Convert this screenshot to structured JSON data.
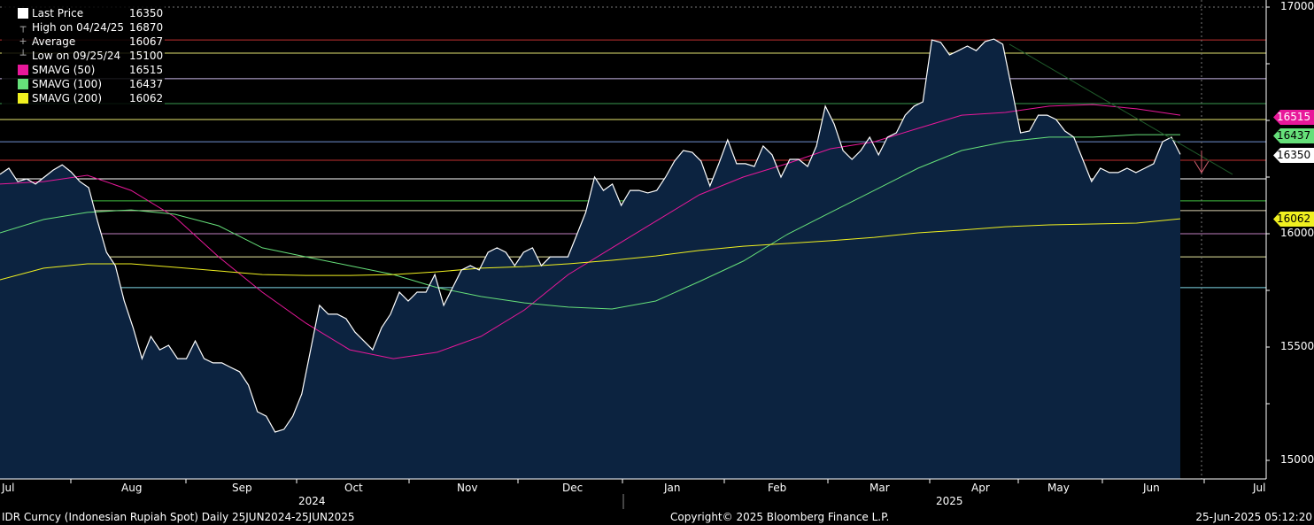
{
  "legend": [
    {
      "label": "Last Price",
      "value": "16350",
      "swatch": "#ffffff",
      "glyph": ""
    },
    {
      "label": "High on 04/24/25",
      "value": "16870",
      "swatch": "",
      "glyph": "┬"
    },
    {
      "label": "Average",
      "value": "16067",
      "swatch": "",
      "glyph": "+"
    },
    {
      "label": "Low on 09/25/24",
      "value": "15100",
      "swatch": "",
      "glyph": "┴"
    },
    {
      "label": "SMAVG (50)",
      "value": "16515",
      "swatch": "#e8189a",
      "glyph": ""
    },
    {
      "label": "SMAVG (100)",
      "value": "16437",
      "swatch": "#66e07a",
      "glyph": ""
    },
    {
      "label": "SMAVG (200)",
      "value": "16062",
      "swatch": "#f0f020",
      "glyph": ""
    }
  ],
  "tags": [
    {
      "value": "16515",
      "bg": "#e8189a",
      "fg": "#ffffff"
    },
    {
      "value": "16437",
      "bg": "#66e07a",
      "fg": "#000000"
    },
    {
      "value": "16350",
      "bg": "#ffffff",
      "fg": "#000000"
    },
    {
      "value": "16062",
      "bg": "#f0f020",
      "fg": "#000000"
    }
  ],
  "chart_data": {
    "type": "line",
    "title": "IDR Curncy (Indonesian Rupiah Spot)",
    "ylim": [
      14920,
      17030
    ],
    "y_ticks": [
      "17000",
      "16000",
      "15500",
      "15000"
    ],
    "y_tick_values": [
      17000,
      16000,
      15500,
      15000
    ],
    "x_months": [
      "Jul",
      "Aug",
      "Sep",
      "Oct",
      "Nov",
      "Dec",
      "Jan",
      "Feb",
      "Mar",
      "Apr",
      "May",
      "Jun",
      "Jul"
    ],
    "x_years": [
      "2024",
      "2025"
    ],
    "series": [
      {
        "name": "Last Price",
        "color": "#ffffff",
        "values": [
          16262,
          16289,
          16230,
          16242,
          16219,
          16250,
          16281,
          16304,
          16273,
          16230,
          16203,
          16055,
          15918,
          15859,
          15703,
          15586,
          15449,
          15547,
          15488,
          15508,
          15449,
          15449,
          15527,
          15449,
          15430,
          15430,
          15410,
          15391,
          15332,
          15215,
          15195,
          15125,
          15137,
          15195,
          15293,
          15488,
          15684,
          15645,
          15645,
          15625,
          15566,
          15527,
          15488,
          15586,
          15645,
          15742,
          15703,
          15742,
          15742,
          15820,
          15684,
          15762,
          15840,
          15859,
          15840,
          15918,
          15938,
          15918,
          15859,
          15918,
          15938,
          15859,
          15898,
          15898,
          15898,
          15996,
          16094,
          16250,
          16191,
          16219,
          16125,
          16191,
          16191,
          16180,
          16191,
          16250,
          16320,
          16367,
          16359,
          16320,
          16211,
          16309,
          16414,
          16309,
          16309,
          16297,
          16387,
          16348,
          16250,
          16328,
          16328,
          16297,
          16387,
          16563,
          16484,
          16367,
          16328,
          16367,
          16426,
          16348,
          16426,
          16445,
          16523,
          16563,
          16582,
          16855,
          16844,
          16789,
          16808,
          16828,
          16808,
          16848,
          16859,
          16836,
          16641,
          16445,
          16453,
          16523,
          16523,
          16504,
          16453,
          16426,
          16328,
          16230,
          16289,
          16270,
          16270,
          16289,
          16270,
          16289,
          16309,
          16406,
          16426,
          16350
        ]
      },
      {
        "name": "SMAVG (50)",
        "color": "#e8189a",
        "values": [
          16219,
          16230,
          16258,
          16191,
          16074,
          15898,
          15742,
          15605,
          15488,
          15449,
          15477,
          15547,
          15664,
          15820,
          15938,
          16055,
          16172,
          16250,
          16309,
          16375,
          16406,
          16465,
          16523,
          16535,
          16563,
          16570,
          16551,
          16523
        ]
      },
      {
        "name": "SMAVG (100)",
        "color": "#66e07a",
        "values": [
          16004,
          16063,
          16094,
          16105,
          16086,
          16035,
          15938,
          15898,
          15859,
          15820,
          15762,
          15723,
          15695,
          15676,
          15668,
          15703,
          15789,
          15879,
          15996,
          16094,
          16191,
          16289,
          16367,
          16406,
          16426,
          16426,
          16437,
          16437
        ]
      },
      {
        "name": "SMAVG (200)",
        "color": "#f0f020",
        "values": [
          15797,
          15848,
          15867,
          15867,
          15852,
          15836,
          15820,
          15816,
          15816,
          15820,
          15832,
          15848,
          15855,
          15867,
          15883,
          15902,
          15926,
          15945,
          15957,
          15969,
          15984,
          16004,
          16016,
          16031,
          16039,
          16043,
          16047,
          16066
        ]
      }
    ],
    "reference_levels": [
      {
        "value": 16855,
        "color": "#c03030"
      },
      {
        "value": 16797,
        "color": "#e0e070"
      },
      {
        "value": 16684,
        "color": "#c8b8e8"
      },
      {
        "value": 16574,
        "color": "#3a9a50"
      },
      {
        "value": 16504,
        "color": "#e8e870"
      },
      {
        "value": 16406,
        "color": "#7090d0"
      },
      {
        "value": 16324,
        "color": "#c03030"
      },
      {
        "value": 16242,
        "color": "#ffffff"
      },
      {
        "value": 16145,
        "color": "#40c040"
      },
      {
        "value": 16102,
        "color": "#d8d0b0"
      },
      {
        "value": 16000,
        "color": "#c080c0"
      },
      {
        "value": 15898,
        "color": "#e8e8a0"
      },
      {
        "value": 15762,
        "color": "#80d8e8"
      }
    ],
    "trendline": {
      "from": 16836,
      "to": 16262,
      "color": "#1f5a2a"
    },
    "forecast_arrow": {
      "color": "#d06070",
      "direction": "down"
    },
    "area_fill": "#0c2340"
  },
  "footer": {
    "left": "IDR Curncy (Indonesian Rupiah Spot)  Daily 25JUN2024-25JUN2025",
    "center": "Copyright© 2025 Bloomberg Finance L.P.",
    "right": "25-Jun-2025 05:12:20"
  }
}
